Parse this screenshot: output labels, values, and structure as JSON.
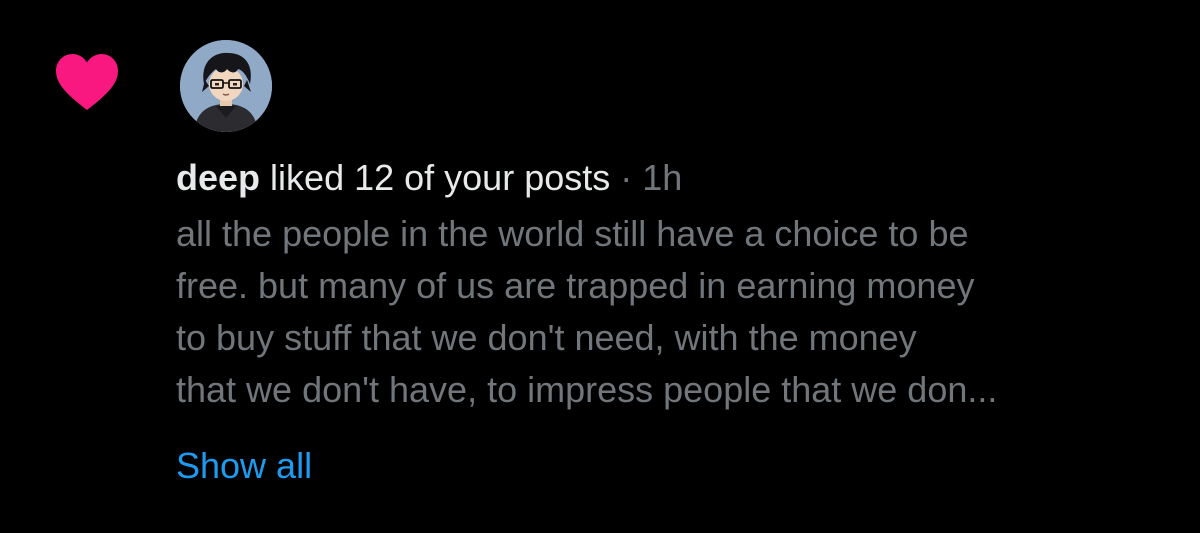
{
  "notification": {
    "type_icon": "heart-icon",
    "accent_color": "#f91880",
    "avatar": "anime-boy-glasses-avatar",
    "user": "deep",
    "action": "liked 12 of your posts",
    "separator": "·",
    "time": "1h",
    "post_lines": [
      "all the people in the world still have a choice to be",
      "free. but many of us are trapped in earning money",
      "to buy stuff that we don't need, with the money",
      "that we don't have, to impress people that we don..."
    ],
    "show_all_label": "Show all",
    "link_color": "#1d9bf0"
  }
}
